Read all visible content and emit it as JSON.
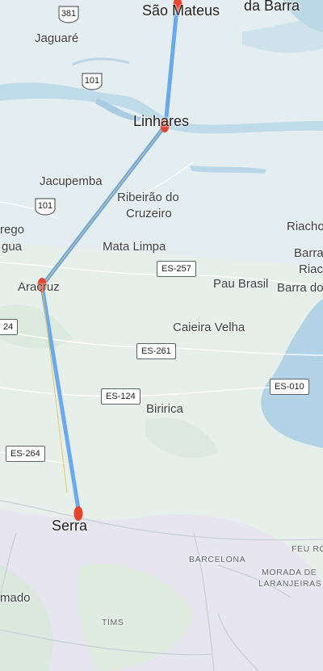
{
  "map": {
    "place_labels": {
      "sao_mateus": "São Mateus",
      "da_barra": "da Barra",
      "jaguare": "Jaguaré",
      "linhares": "Linhares",
      "jacupemba": "Jacupemba",
      "ribeirao_line1": "Ribeirão do",
      "ribeirao_line2": "Cruzeiro",
      "corrego_line1": "rego",
      "corrego_line2": "gua",
      "riacho": "Riacho",
      "barra1": "Barra",
      "riac2": "Riac",
      "barra_do": "Barra do",
      "mata_limpa": "Mata Limpa",
      "pau_brasil": "Pau Brasil",
      "aracruz": "Aracruz",
      "caieira_velha": "Caieira Velha",
      "biririca": "Biririca",
      "serra": "Serra",
      "barcelona": "BARCELONA",
      "feu_rosa": "FEU RO",
      "morada_line1": "MORADA DE",
      "morada_line2": "LARANJEIRAS",
      "tims": "TIMS",
      "mado": "mado"
    },
    "road_shields": {
      "br381": "381",
      "br101_north": "101",
      "br101_south": "101",
      "es257": "ES-257",
      "es261": "ES-261",
      "es124": "ES-124",
      "es010": "ES-010",
      "es264": "ES-264",
      "edge24": "24"
    },
    "route": {
      "stops": [
        "São Mateus",
        "Linhares",
        "Aracruz",
        "Serra"
      ],
      "route_color": "#6aa9f0",
      "marker_color": "#e8432d"
    },
    "colors": {
      "land": "#e6efe9",
      "water": "#b2d3e6",
      "urban": "#e7e5ef"
    }
  }
}
